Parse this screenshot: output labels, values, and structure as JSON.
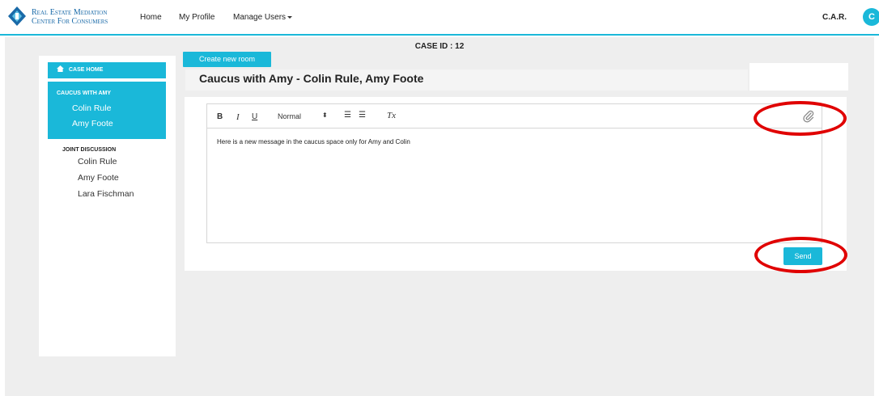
{
  "header": {
    "logo_line1": "Real Estate Mediation",
    "logo_line2": "Center For Consumers",
    "nav": {
      "home": "Home",
      "profile": "My Profile",
      "manage_users": "Manage Users"
    },
    "user_name": "C.A.R.",
    "avatar_initial": "C"
  },
  "case_id_label": "CASE ID : 12",
  "sidebar": {
    "case_home": "CASE HOME",
    "caucus_title": "CAUCUS WITH AMY",
    "caucus_members": [
      "Colin Rule",
      "Amy Foote"
    ],
    "joint_title": "JOINT DISCUSSION",
    "joint_members": [
      "Colin Rule",
      "Amy Foote",
      "Lara Fischman"
    ]
  },
  "content": {
    "create_room": "Create new room",
    "room_title": "Caucus with Amy - Colin Rule, Amy Foote",
    "toolbar": {
      "bold": "B",
      "italic": "I",
      "underline": "U",
      "size": "Normal",
      "size_arrows": "⬍",
      "ordered_list": "☰",
      "bullet_list": "☰",
      "clear_format": "Tx"
    },
    "message": "Here is a new message in the caucus space only for Amy and Colin",
    "send": "Send"
  },
  "colors": {
    "accent": "#1ab8d9",
    "highlight": "#e00000",
    "background": "#eeeeee"
  }
}
